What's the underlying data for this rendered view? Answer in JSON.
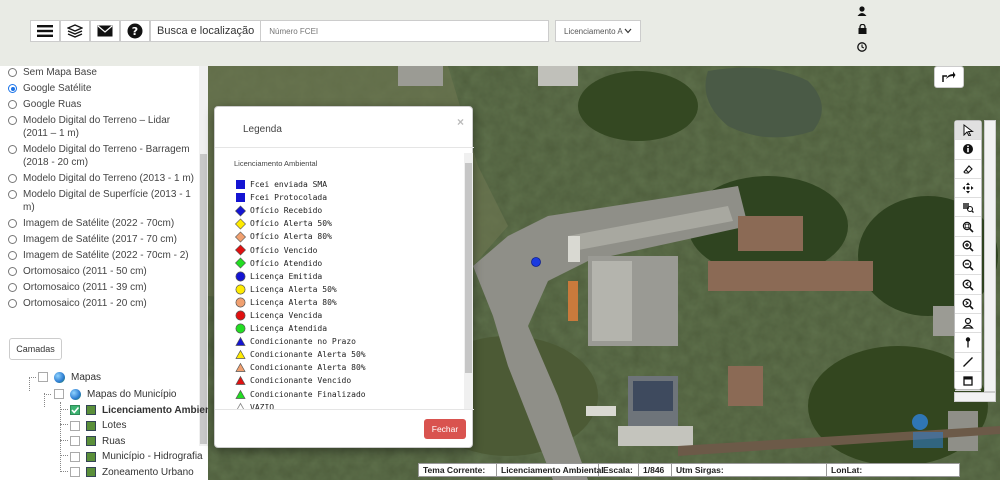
{
  "header": {
    "search_label": "Busca e localização",
    "search_placeholder": "Número FCEI",
    "select_value": "Licenciamento A"
  },
  "icons": {
    "menu": "hamburger-menu-icon",
    "layers": "layers-icon",
    "mail": "envelope-icon",
    "help": "question-mark-icon",
    "user": "user-icon",
    "lock": "lock-icon",
    "clock": "clock-icon",
    "share": "share-icon"
  },
  "base_layers": [
    {
      "label": "Sem Mapa Base",
      "selected": false
    },
    {
      "label": "Google Satélite",
      "selected": true
    },
    {
      "label": "Google Ruas",
      "selected": false
    },
    {
      "label": "Modelo Digital do Terreno – Lidar (2011 – 1 m)",
      "selected": false
    },
    {
      "label": "Modelo Digital do Terreno - Barragem (2018 - 20 cm)",
      "selected": false
    },
    {
      "label": "Modelo Digital do Terreno (2013 - 1 m)",
      "selected": false
    },
    {
      "label": "Modelo Digital de Superfície (2013 - 1 m)",
      "selected": false
    },
    {
      "label": "Imagem de Satélite (2022 - 70cm)",
      "selected": false
    },
    {
      "label": "Imagem de Satélite (2017 - 70 cm)",
      "selected": false
    },
    {
      "label": "Imagem de Satélite (2022 - 70cm - 2)",
      "selected": false
    },
    {
      "label": "Ortomosaico (2011 - 50 cm)",
      "selected": false
    },
    {
      "label": "Ortomosaico (2011 - 39 cm)",
      "selected": false
    },
    {
      "label": "Ortomosaico (2011 - 20 cm)",
      "selected": false
    }
  ],
  "camadas_label": "Camadas",
  "tree": {
    "root": "Mapas",
    "group": "Mapas do Município",
    "items": [
      {
        "label": "Licenciamento Ambiental",
        "checked": true
      },
      {
        "label": "Lotes",
        "checked": false
      },
      {
        "label": "Ruas",
        "checked": false
      },
      {
        "label": "Município - Hidrografia",
        "checked": false
      },
      {
        "label": "Zoneamento Urbano",
        "checked": false
      }
    ]
  },
  "legend": {
    "title": "Legenda",
    "close": "×",
    "subtitle": "Licenciamento Ambiental",
    "button": "Fechar",
    "items": [
      {
        "label": "Fcei enviada SMA",
        "shape": "square",
        "color": "#1414d2"
      },
      {
        "label": "Fcei Protocolada",
        "shape": "square",
        "color": "#1414d2"
      },
      {
        "label": "Ofício Recebido",
        "shape": "diamond",
        "color": "#1414d2"
      },
      {
        "label": "Ofício Alerta 50%",
        "shape": "diamond",
        "color": "#ffeb00"
      },
      {
        "label": "Ofício Alerta 80%",
        "shape": "diamond",
        "color": "#f0a070"
      },
      {
        "label": "Ofício Vencido",
        "shape": "diamond",
        "color": "#e01010"
      },
      {
        "label": "Ofício Atendido",
        "shape": "diamond",
        "color": "#22dd22"
      },
      {
        "label": "Licença Emitida",
        "shape": "circle",
        "color": "#1414d2"
      },
      {
        "label": "Licença Alerta 50%",
        "shape": "circle",
        "color": "#ffeb00"
      },
      {
        "label": "Licença Alerta 80%",
        "shape": "circle",
        "color": "#f0a070"
      },
      {
        "label": "Licença Vencida",
        "shape": "circle",
        "color": "#e01010"
      },
      {
        "label": "Licença Atendida",
        "shape": "circle",
        "color": "#22dd22"
      },
      {
        "label": "Condicionante no Prazo",
        "shape": "triangle",
        "color": "#1414d2"
      },
      {
        "label": "Condicionante Alerta 50%",
        "shape": "triangle",
        "color": "#ffeb00"
      },
      {
        "label": "Condicionante Alerta 80%",
        "shape": "triangle",
        "color": "#f0a070"
      },
      {
        "label": "Condicionante Vencido",
        "shape": "triangle",
        "color": "#e01010"
      },
      {
        "label": "Condicionante Finalizado",
        "shape": "triangle",
        "color": "#22dd22"
      },
      {
        "label": "VAZIO",
        "shape": "triangle-outline",
        "color": "#ffffff"
      }
    ]
  },
  "map_tools": [
    "pointer-icon",
    "info-icon",
    "eraser-icon",
    "move-icon",
    "layers-zoom-icon",
    "zoom-box-icon",
    "zoom-in-icon",
    "zoom-out-icon",
    "zoom-prev-icon",
    "zoom-next-icon",
    "user-location-icon",
    "pin-icon",
    "measure-line-icon",
    "area-icon"
  ],
  "status": {
    "tema_label": "Tema Corrente:",
    "tema_value": "Licenciamento Ambiental",
    "escala_label": "Escala:",
    "escala_value": "1/846",
    "utm_label": "Utm Sirgas:",
    "lonlat_label": "LonLat:"
  }
}
